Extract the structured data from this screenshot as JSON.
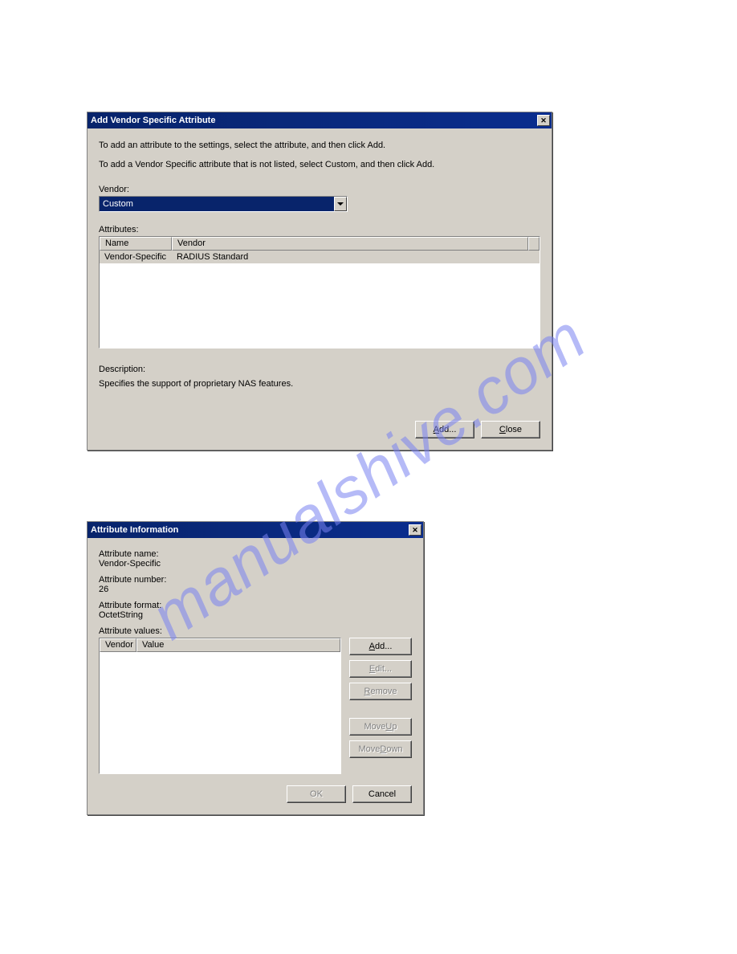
{
  "watermark": "manualshive.com",
  "dlg1": {
    "title": "Add Vendor Specific Attribute",
    "close_glyph": "✕",
    "instr1": "To add an attribute to the settings, select the attribute, and then click Add.",
    "instr2": "To add a Vendor Specific attribute that is not listed, select Custom, and then click Add.",
    "vendor_label": "Vendor:",
    "vendor_value": "Custom",
    "attributes_label": "Attributes:",
    "col_name": "Name",
    "col_vendor": "Vendor",
    "row_name": "Vendor-Specific",
    "row_vendor": "RADIUS Standard",
    "desc_label": "Description:",
    "desc_text": "Specifies the support of proprietary NAS features.",
    "add_pre": "",
    "add_u": "A",
    "add_post": "dd...",
    "close_pre": "",
    "close_u": "C",
    "close_post": "lose"
  },
  "dlg2": {
    "title": "Attribute Information",
    "close_glyph": "✕",
    "name_label": "Attribute name:",
    "name_value": "Vendor-Specific",
    "number_label": "Attribute number:",
    "number_value": "26",
    "format_label": "Attribute format:",
    "format_value": "OctetString",
    "values_label": "Attribute values:",
    "col_vendor": "Vendor",
    "col_value": "Value",
    "add_pre": "",
    "add_u": "A",
    "add_post": "dd...",
    "edit_pre": "",
    "edit_u": "E",
    "edit_post": "dit...",
    "remove_pre": "",
    "remove_u": "R",
    "remove_post": "emove",
    "moveup_pre": "Move ",
    "moveup_u": "U",
    "moveup_post": "p",
    "movedown_pre": "Move ",
    "movedown_u": "D",
    "movedown_post": "own",
    "ok": "OK",
    "cancel": "Cancel"
  }
}
